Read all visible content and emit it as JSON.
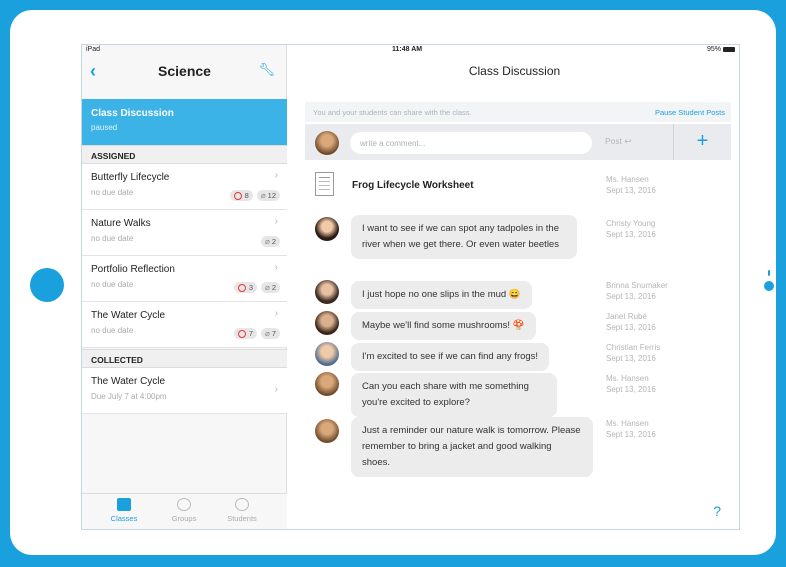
{
  "status": {
    "device": "iPad",
    "time": "11:48 AM",
    "battery": "95%"
  },
  "sidebar": {
    "title": "Science",
    "active": {
      "title": "Class Discussion",
      "status": "paused"
    },
    "assigned_header": "ASSIGNED",
    "assigned": [
      {
        "title": "Butterfly Lifecycle",
        "due": "no due date",
        "red": "8",
        "clip": "12"
      },
      {
        "title": "Nature Walks",
        "due": "no due date",
        "clip": "2"
      },
      {
        "title": "Portfolio Reflection",
        "due": "no due date",
        "red": "3",
        "clip": "2"
      },
      {
        "title": "The Water Cycle",
        "due": "no due date",
        "red": "7",
        "clip": "7"
      }
    ],
    "collected_header": "COLLECTED",
    "collected": [
      {
        "title": "The Water Cycle",
        "due": "Due July 7 at 4:00pm"
      }
    ],
    "tabs": {
      "classes": "Classes",
      "groups": "Groups",
      "students": "Students"
    }
  },
  "main": {
    "title": "Class Discussion",
    "notice": "You and your students can share with the class.",
    "pause_link": "Pause Student Posts",
    "comment_placeholder": "write a comment...",
    "post_label": "Post",
    "plus_label": "+",
    "worksheet": {
      "title": "Frog Lifecycle Worksheet",
      "author": "Ms. Hansen",
      "date": "Sept 13, 2016"
    },
    "posts": [
      {
        "text": "I want to see if we can spot any tadpoles in the river when we get there. Or even water beetles",
        "author": "Christy Young",
        "date": "Sept 13, 2016"
      },
      {
        "text": "I just hope no one slips in the mud 😄",
        "author": "Brinna Snumaker",
        "date": "Sept 13, 2016"
      },
      {
        "text": "Maybe we'll find some mushrooms! 🍄",
        "author": "Janet Rubé",
        "date": "Sept 13, 2016"
      },
      {
        "text": "I'm excited to see if we can find any frogs!",
        "author": "Christian Ferris",
        "date": "Sept 13, 2016"
      },
      {
        "text": "Can you each share with me something you're excited to explore?",
        "author": "Ms. Hansen",
        "date": "Sept 13, 2016"
      },
      {
        "text": "Just a reminder our nature walk is tomorrow. Please remember to bring a jacket and good walking shoes.",
        "author": "Ms. Hansen",
        "date": "Sept 13, 2016"
      }
    ],
    "help": "?"
  },
  "icons": {
    "back": "chevron-left-icon",
    "settings": "wrench-icon",
    "chevron": "chevron-right-icon",
    "red_circle": "incomplete-ring-icon",
    "clip": "paperclip-icon",
    "classes": "folder-icon",
    "groups": "groups-icon",
    "students": "student-icon",
    "post": "send-icon",
    "add": "plus-icon",
    "help": "help-icon",
    "worksheet": "document-icon"
  },
  "colors": {
    "accent": "#1aa0dc",
    "active_row": "#3bb3e6",
    "alert_red": "#e53935"
  }
}
